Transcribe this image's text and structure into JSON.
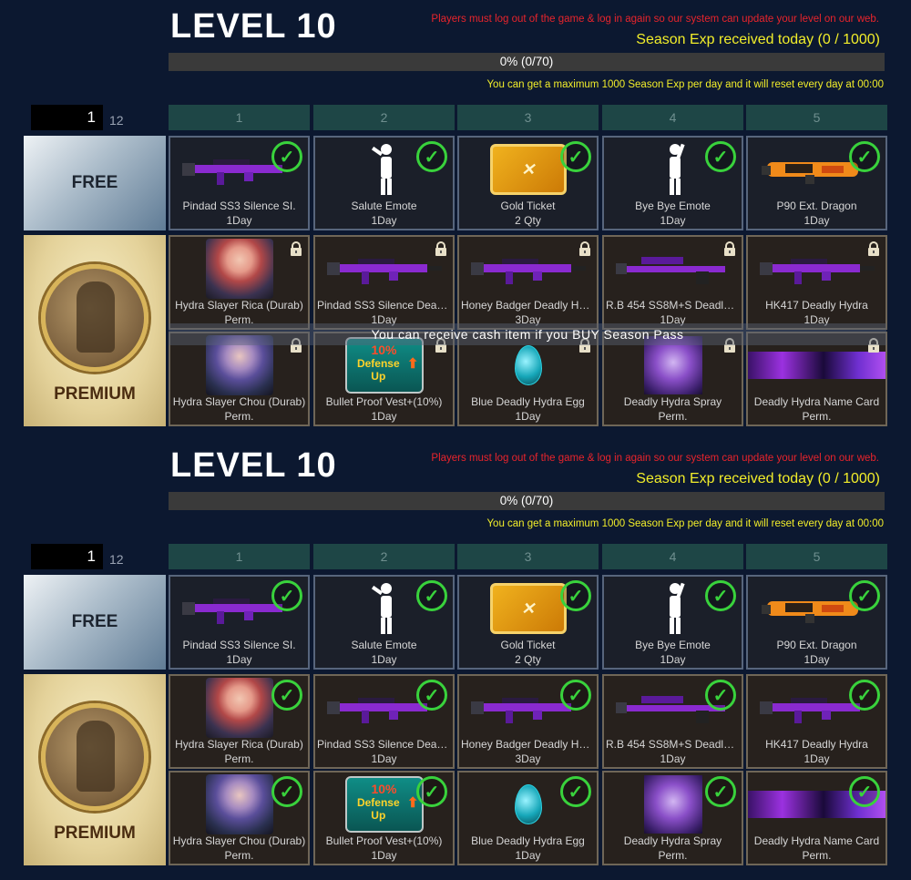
{
  "colors": {
    "background": "#0c1830",
    "notice": "#e8242c",
    "exp": "#f2ee2a",
    "check": "#39d23c",
    "header": "#1e4646"
  },
  "panels": [
    {
      "level_title": "LEVEL 10",
      "notice": "Players must log out of the game & log in again so our system can update your level on our web.",
      "exp_text": "Season Exp received today (0 / 1000)",
      "progress_text": "0% (0/70)",
      "progress_fraction": 0,
      "max_notice": "You can get a maximum 1000 Season Exp per day and it will reset every day at 00:00",
      "page_value": "1",
      "page_total": "12",
      "columns": [
        "1",
        "2",
        "3",
        "4",
        "5"
      ],
      "free_label": "FREE",
      "premium_label": "PREMIUM",
      "overlay_text": "You can receive cash item if you BUY Season Pass",
      "free_items": [
        {
          "name": "Pindad SS3 Silence SI.",
          "duration": "1Day",
          "icon": "rifle-icon",
          "status": "claimed"
        },
        {
          "name": "Salute Emote",
          "duration": "1Day",
          "icon": "salute-emote-icon",
          "status": "claimed"
        },
        {
          "name": "Gold Ticket",
          "duration": "2 Qty",
          "icon": "gold-ticket-icon",
          "status": "claimed"
        },
        {
          "name": "Bye Bye Emote",
          "duration": "1Day",
          "icon": "wave-emote-icon",
          "status": "claimed"
        },
        {
          "name": "P90 Ext. Dragon",
          "duration": "1Day",
          "icon": "smg-icon",
          "status": "claimed"
        }
      ],
      "premium_items_row1": [
        {
          "name": "Hydra Slayer Rica (Durab)",
          "duration": "Perm.",
          "icon": "character-icon",
          "status": "locked"
        },
        {
          "name": "Pindad SS3 Silence Deadl...",
          "duration": "1Day",
          "icon": "rifle-icon",
          "status": "locked"
        },
        {
          "name": "Honey Badger Deadly Hydra",
          "duration": "3Day",
          "icon": "rifle-icon",
          "status": "locked"
        },
        {
          "name": "R.B 454 SS8M+S Deadly ...",
          "duration": "1Day",
          "icon": "sniper-icon",
          "status": "locked"
        },
        {
          "name": "HK417 Deadly Hydra",
          "duration": "1Day",
          "icon": "rifle-icon",
          "status": "locked"
        }
      ],
      "premium_items_row2": [
        {
          "name": "Hydra Slayer Chou (Durab)",
          "duration": "Perm.",
          "icon": "character-icon",
          "status": "locked"
        },
        {
          "name": "Bullet Proof Vest+(10%)",
          "duration": "1Day",
          "icon": "vest-icon",
          "status": "locked"
        },
        {
          "name": "Blue Deadly Hydra Egg",
          "duration": "1Day",
          "icon": "egg-icon",
          "status": "locked"
        },
        {
          "name": "Deadly Hydra Spray",
          "duration": "Perm.",
          "icon": "spray-icon",
          "status": "locked"
        },
        {
          "name": "Deadly Hydra Name Card",
          "duration": "Perm.",
          "icon": "name-card-icon",
          "status": "locked"
        }
      ]
    },
    {
      "level_title": "LEVEL 10",
      "notice": "Players must log out of the game & log in again so our system can update your level on our web.",
      "exp_text": "Season Exp received today (0 / 1000)",
      "progress_text": "0% (0/70)",
      "progress_fraction": 0,
      "max_notice": "You can get a maximum 1000 Season Exp per day and it will reset every day at 00:00",
      "page_value": "1",
      "page_total": "12",
      "columns": [
        "1",
        "2",
        "3",
        "4",
        "5"
      ],
      "free_label": "FREE",
      "premium_label": "PREMIUM",
      "free_items": [
        {
          "name": "Pindad SS3 Silence SI.",
          "duration": "1Day",
          "icon": "rifle-icon",
          "status": "claimed"
        },
        {
          "name": "Salute Emote",
          "duration": "1Day",
          "icon": "salute-emote-icon",
          "status": "claimed"
        },
        {
          "name": "Gold Ticket",
          "duration": "2 Qty",
          "icon": "gold-ticket-icon",
          "status": "claimed"
        },
        {
          "name": "Bye Bye Emote",
          "duration": "1Day",
          "icon": "wave-emote-icon",
          "status": "claimed"
        },
        {
          "name": "P90 Ext. Dragon",
          "duration": "1Day",
          "icon": "smg-icon",
          "status": "claimed"
        }
      ],
      "premium_items_row1": [
        {
          "name": "Hydra Slayer Rica (Durab)",
          "duration": "Perm.",
          "icon": "character-icon",
          "status": "claimed"
        },
        {
          "name": "Pindad SS3 Silence Deadl...",
          "duration": "1Day",
          "icon": "rifle-icon",
          "status": "claimed"
        },
        {
          "name": "Honey Badger Deadly Hydra",
          "duration": "3Day",
          "icon": "rifle-icon",
          "status": "claimed"
        },
        {
          "name": "R.B 454 SS8M+S Deadly ...",
          "duration": "1Day",
          "icon": "sniper-icon",
          "status": "claimed"
        },
        {
          "name": "HK417 Deadly Hydra",
          "duration": "1Day",
          "icon": "rifle-icon",
          "status": "claimed"
        }
      ],
      "premium_items_row2": [
        {
          "name": "Hydra Slayer Chou (Durab)",
          "duration": "Perm.",
          "icon": "character-icon",
          "status": "claimed"
        },
        {
          "name": "Bullet Proof Vest+(10%)",
          "duration": "1Day",
          "icon": "vest-icon",
          "status": "claimed"
        },
        {
          "name": "Blue Deadly Hydra Egg",
          "duration": "1Day",
          "icon": "egg-icon",
          "status": "claimed"
        },
        {
          "name": "Deadly Hydra Spray",
          "duration": "Perm.",
          "icon": "spray-icon",
          "status": "claimed"
        },
        {
          "name": "Deadly Hydra Name Card",
          "duration": "Perm.",
          "icon": "name-card-icon",
          "status": "claimed"
        }
      ],
      "vest_badge": {
        "pct": "10%",
        "text": "Defense Up"
      }
    }
  ]
}
